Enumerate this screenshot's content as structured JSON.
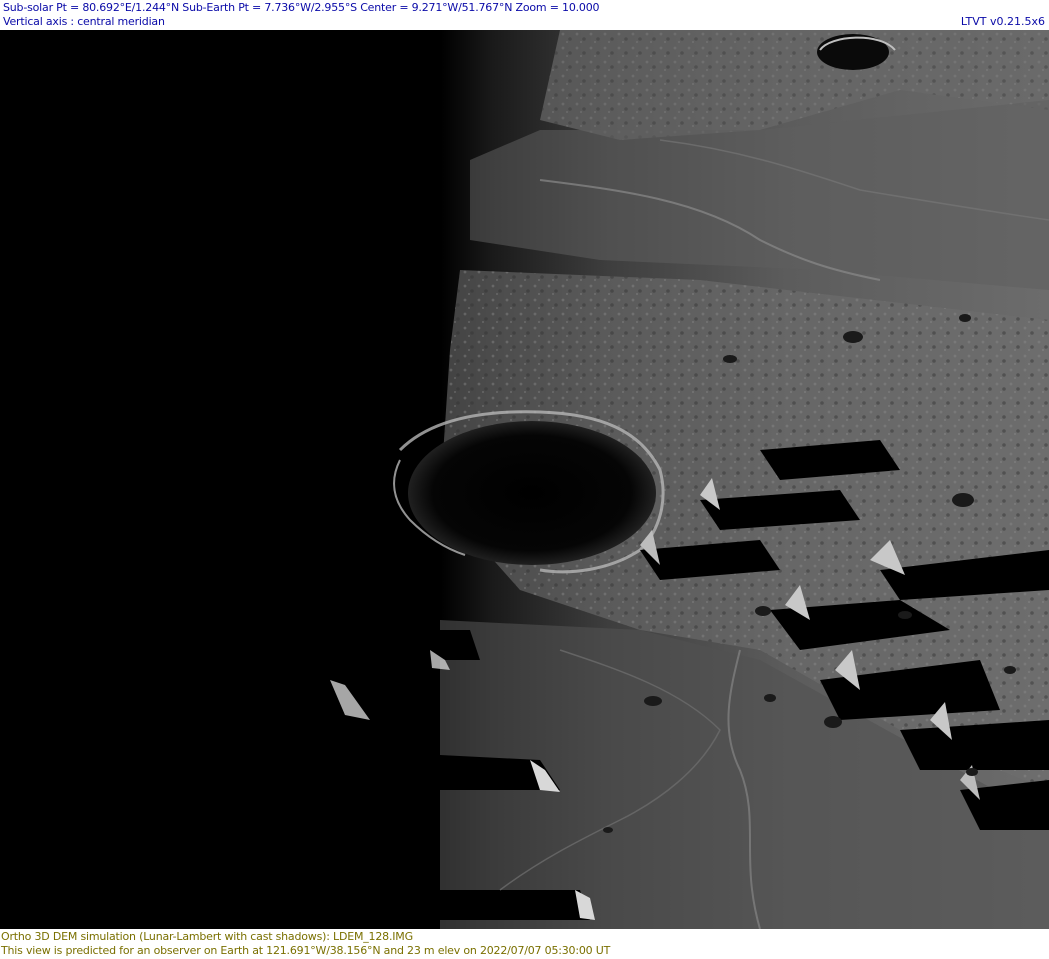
{
  "header": {
    "line1": "Sub-solar Pt = 80.692°E/1.244°N  Sub-Earth Pt = 7.736°W/2.955°S Center = 9.271°W/51.767°N  Zoom = 10.000",
    "line2": "Vertical axis : central meridian",
    "version": "LTVT v0.21.5x6"
  },
  "footer": {
    "line1": "Ortho 3D DEM simulation (Lunar-Lambert with cast shadows): LDEM_128.IMG",
    "line2": "This view is predicted for an observer on Earth at 121.691°W/38.156°N and 23 m elev on 2022/07/07 05:30:00 UT"
  },
  "colors": {
    "header_text": "#0a0aa8",
    "footer_text": "#7a7000",
    "shadow": "#000000",
    "mare": "#5a5a5a",
    "highlands": "#7a7a7a"
  }
}
